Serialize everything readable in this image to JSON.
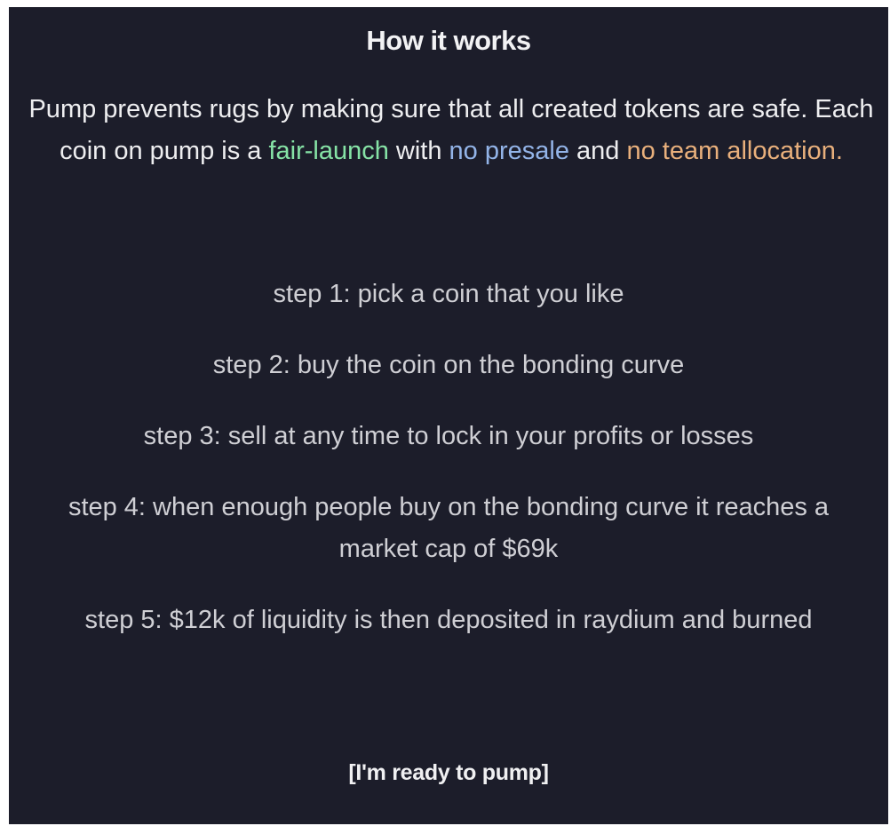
{
  "modal": {
    "title": "How it works",
    "intro": {
      "part1": "Pump prevents rugs by making sure that all created tokens are safe. Each coin on pump is a ",
      "highlight1": "fair-launch",
      "part2": " with ",
      "highlight2": "no presale",
      "part3": " and ",
      "highlight3": "no team allocation."
    },
    "steps": [
      "step 1: pick a coin that you like",
      "step 2: buy the coin on the bonding curve",
      "step 3: sell at any time to lock in your profits or losses",
      "step 4: when enough people buy on the bonding curve it reaches a market cap of $69k",
      "step 5: $12k of liquidity is then deposited in raydium and burned"
    ],
    "cta_label": "[I'm ready to pump]",
    "colors": {
      "background": "#1c1d2a",
      "highlight_green": "#86e3a6",
      "highlight_blue": "#93b4e8",
      "highlight_orange": "#e9b07c"
    }
  }
}
